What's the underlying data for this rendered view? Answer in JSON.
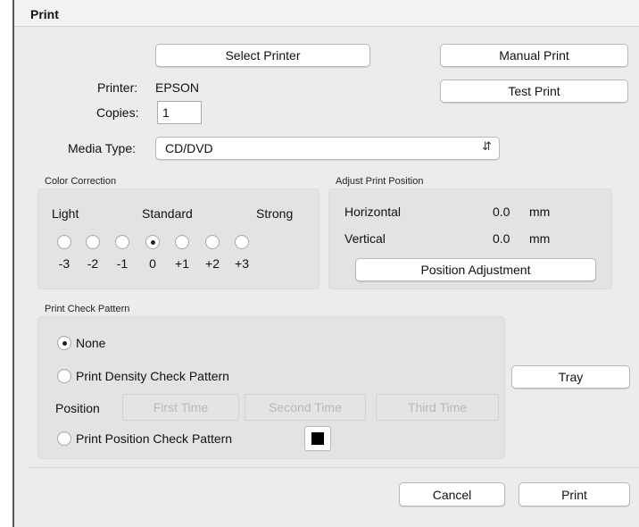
{
  "window": {
    "title": "Print"
  },
  "top": {
    "select_printer": "Select Printer",
    "manual_print": "Manual Print",
    "test_print": "Test Print",
    "printer_label": "Printer:",
    "printer_value": "EPSON",
    "copies_label": "Copies:",
    "copies_value": "1",
    "media_type_label": "Media Type:",
    "media_type_value": "CD/DVD"
  },
  "color_correction": {
    "title": "Color Correction",
    "light": "Light",
    "standard": "Standard",
    "strong": "Strong",
    "levels": [
      "-3",
      "-2",
      "-1",
      "0",
      "+1",
      "+2",
      "+3"
    ],
    "selected": "0"
  },
  "adjust_position": {
    "title": "Adjust Print Position",
    "horizontal_label": "Horizontal",
    "horizontal_value": "0.0",
    "horizontal_unit": "mm",
    "vertical_label": "Vertical",
    "vertical_value": "0.0",
    "vertical_unit": "mm",
    "position_adjustment": "Position Adjustment"
  },
  "check_pattern": {
    "title": "Print Check Pattern",
    "none": "None",
    "density": "Print Density Check Pattern",
    "position_label": "Position",
    "first_time": "First Time",
    "second_time": "Second Time",
    "third_time": "Third Time",
    "position_pattern": "Print Position Check Pattern",
    "selected": "None",
    "swatch_color": "#000000"
  },
  "tray": "Tray",
  "footer": {
    "cancel": "Cancel",
    "print": "Print"
  }
}
